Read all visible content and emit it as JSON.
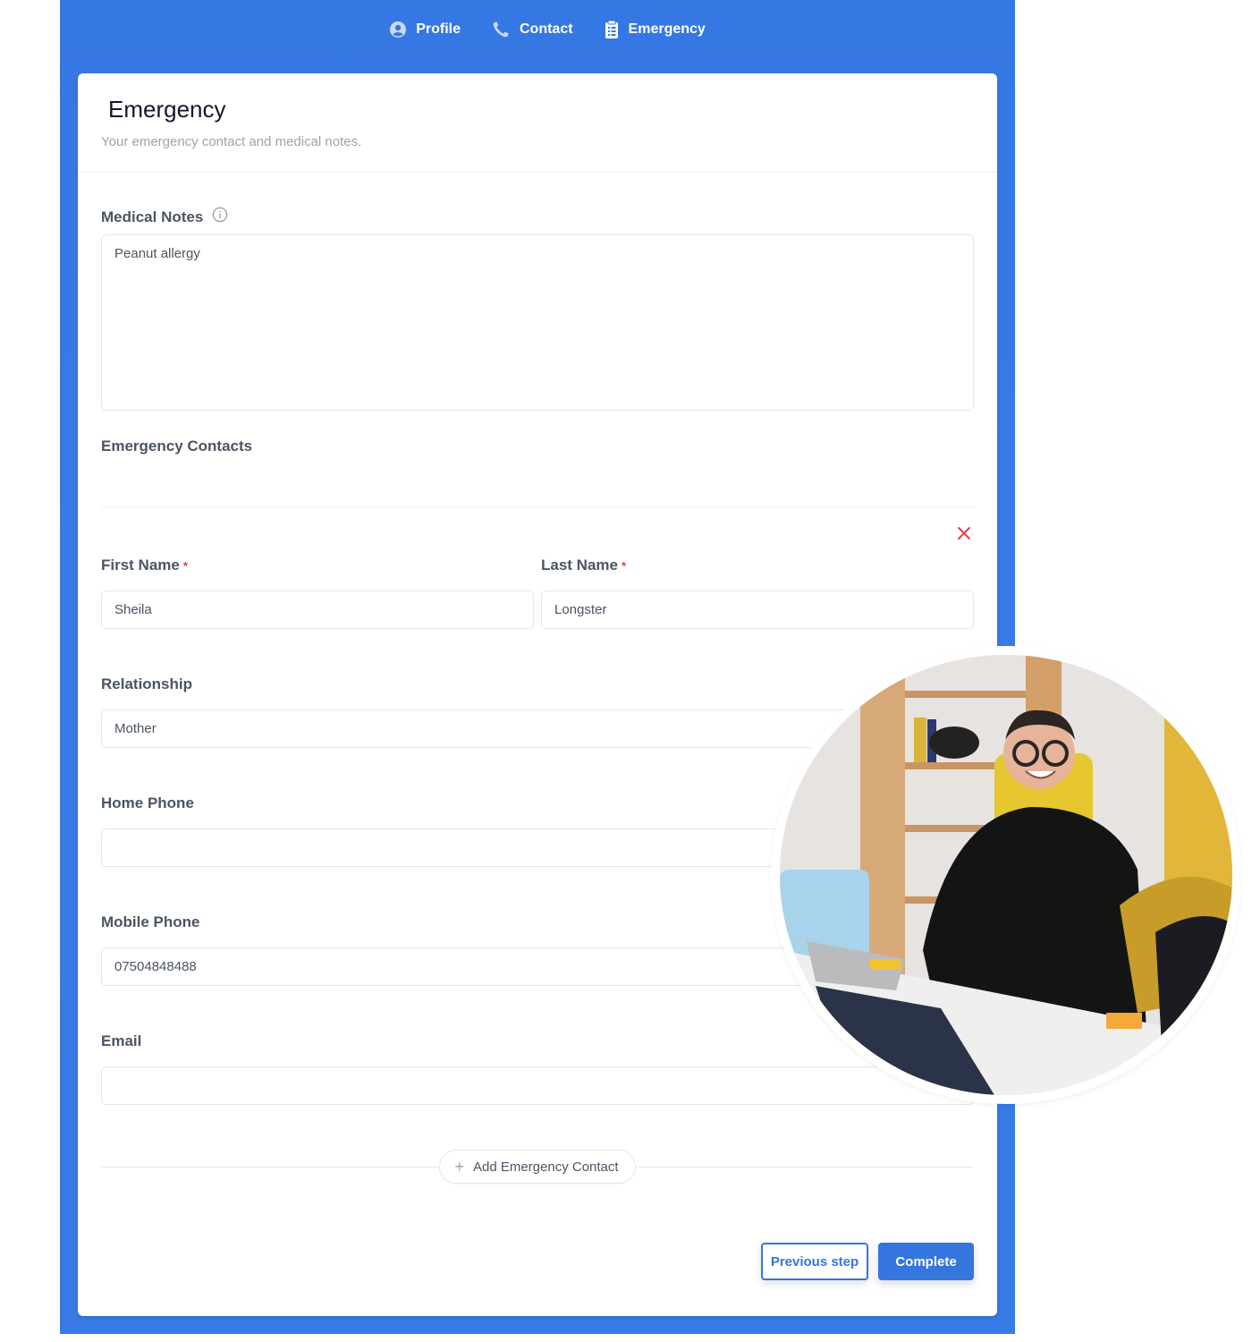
{
  "nav": {
    "items": [
      {
        "label": "Profile",
        "icon": "user-circle-icon"
      },
      {
        "label": "Contact",
        "icon": "phone-icon"
      },
      {
        "label": "Emergency",
        "icon": "clipboard-list-icon"
      }
    ]
  },
  "card": {
    "title": "Emergency",
    "subtitle": "Your emergency contact and medical notes."
  },
  "medical": {
    "label": "Medical Notes",
    "value": "Peanut allergy"
  },
  "contacts": {
    "section_label": "Emergency Contacts",
    "first_name": {
      "label": "First Name",
      "required": "*",
      "value": "Sheila"
    },
    "last_name": {
      "label": "Last Name",
      "required": "*",
      "value": "Longster"
    },
    "relationship": {
      "label": "Relationship",
      "value": "Mother"
    },
    "home_phone": {
      "label": "Home Phone",
      "value": ""
    },
    "mobile_phone": {
      "label": "Mobile Phone",
      "value": "07504848488"
    },
    "email": {
      "label": "Email",
      "value": ""
    },
    "add_button": "Add Emergency Contact"
  },
  "actions": {
    "previous": "Previous step",
    "complete": "Complete"
  },
  "colors": {
    "brand": "#3575de",
    "required": "#e53e3e",
    "remove": "#e53e3e"
  }
}
